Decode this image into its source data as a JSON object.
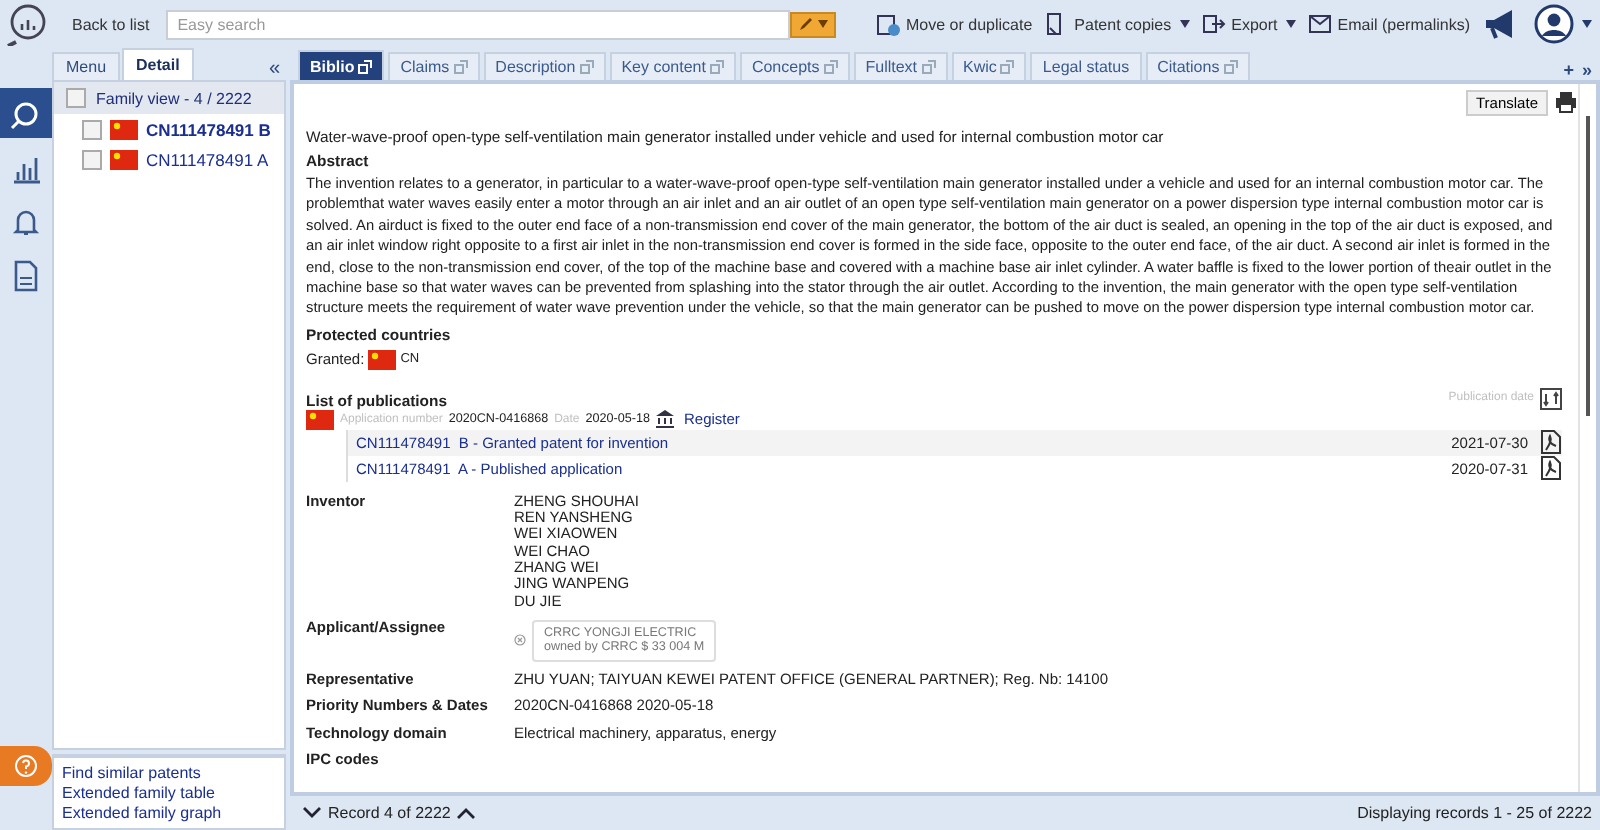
{
  "toolbar": {
    "back": "Back to list",
    "search": {
      "placeholder": "Easy search"
    },
    "actions": [
      {
        "label": "Move or duplicate",
        "dropdown": false
      },
      {
        "label": "Patent copies",
        "dropdown": true
      },
      {
        "label": "Export",
        "dropdown": true
      },
      {
        "label": "Email (permalinks)",
        "dropdown": false
      }
    ]
  },
  "rail": [
    {
      "kind": "search",
      "selected": true
    },
    {
      "kind": "chart",
      "selected": false
    },
    {
      "kind": "bell",
      "selected": false
    },
    {
      "kind": "document",
      "selected": false
    }
  ],
  "side_tabs": [
    {
      "label": "Menu",
      "selected": false
    },
    {
      "label": "Detail",
      "selected": true
    }
  ],
  "side_collapse": "«",
  "family": {
    "header": "Family view - 4 / 2222",
    "checked": false,
    "items": [
      {
        "number": "CN111478491 B",
        "checked": false,
        "selected": true
      },
      {
        "number": "CN111478491 A",
        "checked": false,
        "selected": false
      }
    ]
  },
  "side_links": [
    "Find similar patents",
    "Extended family table",
    "Extended family graph"
  ],
  "tabs": [
    {
      "label": "Biblio",
      "selected": true,
      "popout": true
    },
    {
      "label": "Claims",
      "selected": false,
      "popout": true
    },
    {
      "label": "Description",
      "selected": false,
      "popout": true
    },
    {
      "label": "Key content",
      "selected": false,
      "popout": true
    },
    {
      "label": "Concepts",
      "selected": false,
      "popout": true
    },
    {
      "label": "Fulltext",
      "selected": false,
      "popout": true
    },
    {
      "label": "Kwic",
      "selected": false,
      "popout": true
    },
    {
      "label": "Legal status",
      "selected": false,
      "popout": false
    },
    {
      "label": "Citations",
      "selected": false,
      "popout": true
    }
  ],
  "tab_tools": [
    "+",
    "»"
  ],
  "translate": "Translate",
  "title": "Water-wave-proof open-type self-ventilation main generator installed under vehicle and used for internal combustion motor car",
  "abstract": {
    "heading": "Abstract",
    "text": "The invention relates to a generator, in particular to a water-wave-proof open-type self-ventilation main generator installed under a vehicle and used for an internal combustion motor car. The problemthat water waves easily enter a motor through an air inlet and an air outlet of an open type self-ventilation main generator on a power dispersion type internal combustion motor car is solved. An airduct is fixed to the outer end face of a non-transmission end cover of the main generator, the bottom of the air duct is sealed, an opening in the top of the air duct is exposed, and an air inlet window right opposite to a first air inlet in the non-transmission end cover is formed in the side face, opposite to the outer end face, of the air duct. A second air inlet is formed in the end, close to the non-transmission end cover, of the top of the machine base and covered with a machine base air inlet cylinder. A water baffle is fixed to the lower portion of theair outlet in the machine base so that water waves can be prevented from splashing into the stator through the air outlet. According to the invention, the main generator with the open type self-ventilation structure meets the requirement of water wave prevention under the vehicle, so that the main generator can be pushed to move on the power dispersion type internal combustion motor car."
  },
  "protected": {
    "heading": "Protected countries",
    "label": "Granted:",
    "country": "CN"
  },
  "publications": {
    "heading": "List of publications",
    "sort_label": "Publication date",
    "application_label": "Application number",
    "application_number": "2020CN-0416868",
    "date_label": "Date",
    "date": "2020-05-18",
    "register": "Register",
    "items": [
      {
        "number": "CN111478491",
        "title": "B - Granted patent for invention",
        "date": "2021-07-30",
        "highlighted": true
      },
      {
        "number": "CN111478491",
        "title": "A - Published application",
        "date": "2020-07-31",
        "highlighted": false
      }
    ]
  },
  "fields": [
    {
      "label": "Inventor",
      "kind": "list",
      "values": [
        "ZHENG SHOUHAI",
        "REN YANSHENG",
        "WEI XIAOWEN",
        "WEI CHAO",
        "ZHANG WEI",
        "JING WANPENG",
        "DU JIE"
      ]
    },
    {
      "label": "Applicant/Assignee",
      "kind": "company",
      "name": "CRRC YONGJI ELECTRIC",
      "owner": "owned by CRRC $ 33 004 M"
    },
    {
      "label": "Representative",
      "kind": "text",
      "value": "ZHU YUAN; TAIYUAN KEWEI PATENT OFFICE (GENERAL PARTNER); Reg. Nb: 14100"
    },
    {
      "label": "Priority Numbers & Dates",
      "kind": "text",
      "value": "2020CN-0416868 2020-05-18"
    },
    {
      "label": "Technology domain",
      "kind": "text",
      "value": "Electrical machinery, apparatus, energy"
    },
    {
      "label": "IPC codes",
      "kind": "text"
    }
  ],
  "footer": {
    "record": "Record 4 of 2222",
    "displaying": "Displaying records 1 - 25 of 2222"
  }
}
